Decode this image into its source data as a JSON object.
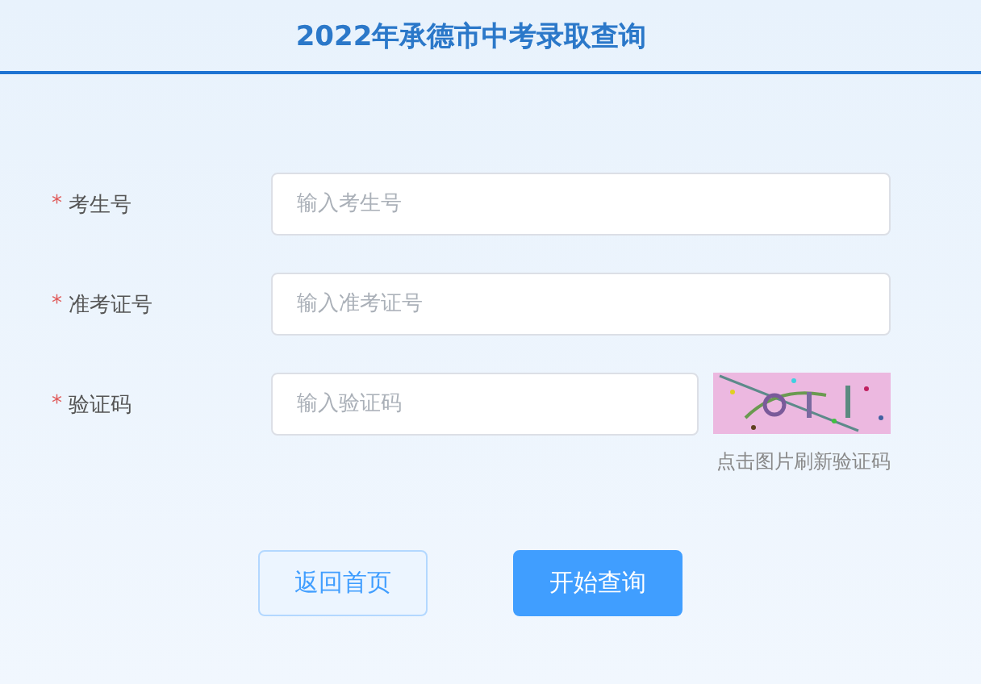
{
  "header": {
    "title": "2022年承德市中考录取查询"
  },
  "fields": [
    {
      "label": "考生号",
      "required_mark": "*",
      "placeholder": "输入考生号",
      "kind": "text"
    },
    {
      "label": "准考证号",
      "required_mark": "*",
      "placeholder": "输入准考证号",
      "kind": "text"
    },
    {
      "label": "验证码",
      "required_mark": "*",
      "placeholder": "输入验证码",
      "kind": "captcha",
      "hint": "点击图片刷新验证码"
    }
  ],
  "buttons": [
    {
      "label": "返回首页",
      "kind": "secondary"
    },
    {
      "label": "开始查询",
      "kind": "primary"
    }
  ]
}
